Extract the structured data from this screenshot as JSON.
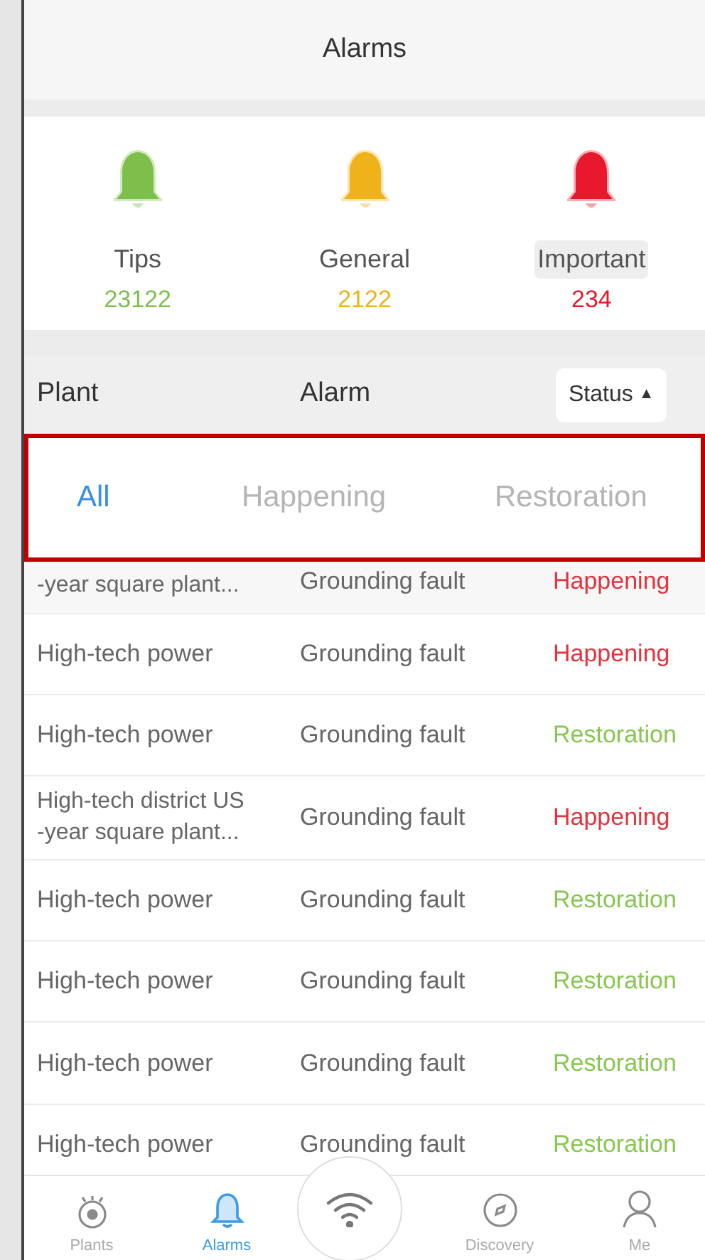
{
  "header": {
    "title": "Alarms"
  },
  "summary": [
    {
      "label": "Tips",
      "count": "23122",
      "color": "#7dbf4a",
      "highlighted": false
    },
    {
      "label": "General",
      "count": "2122",
      "color": "#f0b21a",
      "highlighted": false
    },
    {
      "label": "Important",
      "count": "234",
      "color": "#e8192c",
      "highlighted": true
    }
  ],
  "table": {
    "columns": [
      "Plant",
      "Alarm"
    ],
    "status_button": {
      "label": "Status",
      "arrow": "▲"
    }
  },
  "filter": {
    "options": [
      {
        "label": "All",
        "selected": true
      },
      {
        "label": "Happening",
        "selected": false
      },
      {
        "label": "Restoration",
        "selected": false
      }
    ]
  },
  "rows": [
    {
      "plant": [
        "-year square plant..."
      ],
      "alarm": "Grounding fault",
      "status": "Happening",
      "kind": "happening",
      "partial": true
    },
    {
      "plant": [
        "High-tech power"
      ],
      "alarm": "Grounding fault",
      "status": "Happening",
      "kind": "happening",
      "partial": false
    },
    {
      "plant": [
        "High-tech power"
      ],
      "alarm": "Grounding fault",
      "status": "Restoration",
      "kind": "restoration",
      "partial": false
    },
    {
      "plant": [
        "High-tech district US",
        "-year square plant..."
      ],
      "alarm": "Grounding fault",
      "status": "Happening",
      "kind": "happening",
      "partial": false
    },
    {
      "plant": [
        "High-tech power"
      ],
      "alarm": "Grounding fault",
      "status": "Restoration",
      "kind": "restoration",
      "partial": false
    },
    {
      "plant": [
        "High-tech power"
      ],
      "alarm": "Grounding fault",
      "status": "Restoration",
      "kind": "restoration",
      "partial": false
    },
    {
      "plant": [
        "High-tech power"
      ],
      "alarm": "Grounding fault",
      "status": "Restoration",
      "kind": "restoration",
      "partial": false
    },
    {
      "plant": [
        "High-tech power"
      ],
      "alarm": "Grounding fault",
      "status": "Restoration",
      "kind": "restoration",
      "partial": false
    }
  ],
  "nav": [
    {
      "label": "Plants",
      "kind": "eye",
      "selected": false
    },
    {
      "label": "Alarms",
      "kind": "bell",
      "selected": true
    },
    {
      "kind": "wifi",
      "selected": false
    },
    {
      "label": "Discovery",
      "kind": "compass",
      "selected": false
    },
    {
      "label": "Me",
      "kind": "person",
      "selected": false
    }
  ]
}
